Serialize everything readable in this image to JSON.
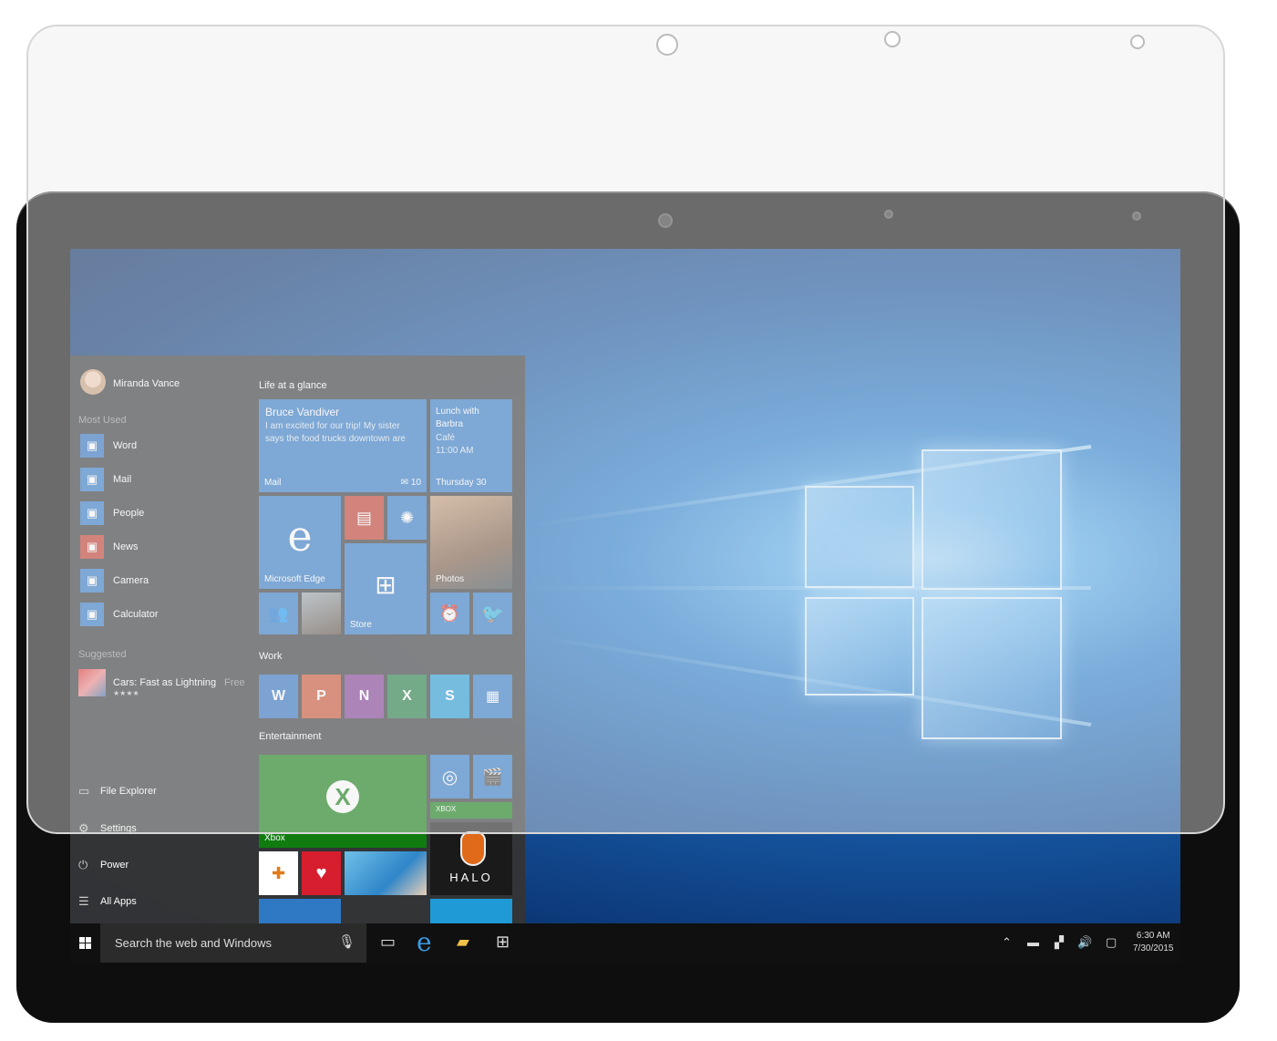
{
  "start_menu": {
    "user_name": "Miranda Vance",
    "most_used_header": "Most Used",
    "most_used": [
      {
        "label": "Word",
        "icon": "word-icon",
        "color": "#2b6fbf"
      },
      {
        "label": "Mail",
        "icon": "mail-icon",
        "color": "#2f78c4"
      },
      {
        "label": "People",
        "icon": "people-icon",
        "color": "#2f78c4"
      },
      {
        "label": "News",
        "icon": "news-icon",
        "color": "#c0392b"
      },
      {
        "label": "Camera",
        "icon": "camera-icon",
        "color": "#2f78c4"
      },
      {
        "label": "Calculator",
        "icon": "calculator-icon",
        "color": "#2f78c4"
      }
    ],
    "suggested_header": "Suggested",
    "suggested": {
      "label": "Cars: Fast as Lightning",
      "badge": "Free",
      "rating": "★★★★"
    },
    "bottom": {
      "file_explorer": "File Explorer",
      "settings": "Settings",
      "power": "Power",
      "all_apps": "All Apps"
    },
    "groups": {
      "life": "Life at a glance",
      "work": "Work",
      "entertainment": "Entertainment"
    },
    "tiles": {
      "mail_sender": "Bruce Vandiver",
      "mail_preview": "I am excited for our trip! My sister says the food trucks downtown are",
      "mail_label": "Mail",
      "mail_count": "10",
      "cal_event": "Lunch with Barbra",
      "cal_place": "Café",
      "cal_time": "11:00 AM",
      "cal_day": "Thursday 30",
      "edge_label": "Microsoft Edge",
      "store_label": "Store",
      "photos_label": "Photos",
      "xbox_label": "Xbox",
      "xbox_small": "XBOX",
      "halo_label": "HALO"
    }
  },
  "taskbar": {
    "search_placeholder": "Search the web and Windows",
    "time": "6:30 AM",
    "date": "7/30/2015"
  },
  "colors": {
    "tile_blue": "#2f78c4",
    "xbox_green": "#107c10",
    "news_red": "#c0392b"
  }
}
